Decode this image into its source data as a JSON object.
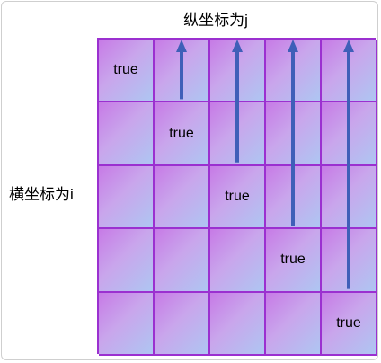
{
  "labels": {
    "column_axis": "纵坐标为j",
    "row_axis": "横坐标为i"
  },
  "grid": {
    "rows": 5,
    "cols": 5,
    "cells": [
      [
        "true",
        "",
        "",
        "",
        ""
      ],
      [
        "",
        "true",
        "",
        "",
        ""
      ],
      [
        "",
        "",
        "true",
        "",
        ""
      ],
      [
        "",
        "",
        "",
        "true",
        ""
      ],
      [
        "",
        "",
        "",
        "",
        "true"
      ]
    ]
  },
  "arrows": [
    {
      "col": 1,
      "from_row": 0
    },
    {
      "col": 2,
      "from_row": 1
    },
    {
      "col": 3,
      "from_row": 2
    },
    {
      "col": 4,
      "from_row": 3
    }
  ],
  "colors": {
    "grid_line": "#9b30d0",
    "arrow": "#3f5fb8"
  }
}
